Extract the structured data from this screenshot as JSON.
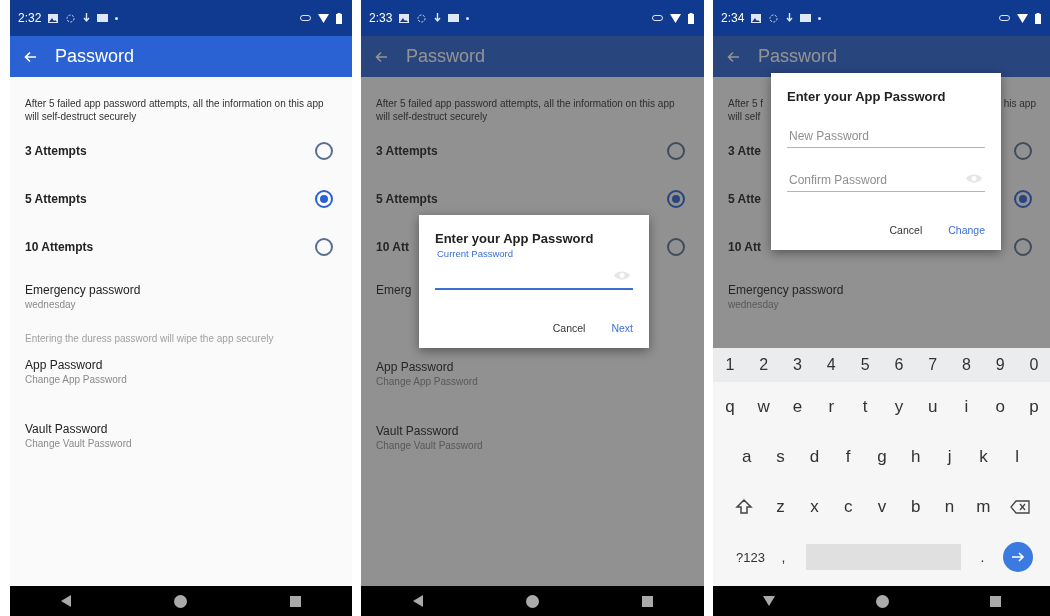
{
  "phones": [
    {
      "status_time": "2:32",
      "title": "Password",
      "description": "After 5 failed app password attempts, all the information on this app will self-destruct securely",
      "options": [
        {
          "label": "3 Attempts",
          "selected": false
        },
        {
          "label": "5 Attempts",
          "selected": true
        },
        {
          "label": "10 Attempts",
          "selected": false
        }
      ],
      "emergency": {
        "title": "Emergency password",
        "subtitle": "wednesday"
      },
      "note": "Entering the duress password will wipe the app securely",
      "settings": [
        {
          "title": "App Password",
          "subtitle": "Change App Password"
        },
        {
          "title": "Vault Password",
          "subtitle": "Change Vault Password"
        }
      ]
    },
    {
      "status_time": "2:33",
      "title": "Password",
      "description": "After 5 failed app password attempts, all the information on this app will self-destruct securely",
      "options": [
        {
          "label": "3 Attempts",
          "selected": false
        },
        {
          "label": "5 Attempts",
          "selected": true
        },
        {
          "label": "10 Att",
          "selected": false
        }
      ],
      "emergency": {
        "title": "Emerg"
      },
      "settings": [
        {
          "title": "App Password",
          "subtitle": "Change App Password"
        },
        {
          "title": "Vault Password",
          "subtitle": "Change Vault Password"
        }
      ],
      "dialog": {
        "title": "Enter your App Password",
        "fields": [
          {
            "label": "Current Password",
            "show_toggle": true,
            "focused": true
          }
        ],
        "buttons": [
          {
            "label": "Cancel",
            "primary": false
          },
          {
            "label": "Next",
            "primary": true
          }
        ]
      }
    },
    {
      "status_time": "2:34",
      "title": "Password",
      "description_fragments": [
        {
          "left": "After 5 f",
          "right": "his app"
        },
        {
          "left": "will self"
        }
      ],
      "options": [
        {
          "label": "3 Atte",
          "selected": false
        },
        {
          "label": "5 Atte",
          "selected": true
        },
        {
          "label": "10 Att",
          "selected": false
        }
      ],
      "emergency": {
        "title": "Emergency password",
        "subtitle": "wednesday"
      },
      "dialog": {
        "title": "Enter your App Password",
        "fields": [
          {
            "placeholder": "New Password",
            "show_toggle": false,
            "focused": false
          },
          {
            "placeholder": "Confirm Password",
            "show_toggle": true,
            "focused": false
          }
        ],
        "buttons": [
          {
            "label": "Cancel",
            "primary": false
          },
          {
            "label": "Change",
            "primary": true
          }
        ]
      },
      "keyboard": {
        "number_row": [
          "1",
          "2",
          "3",
          "4",
          "5",
          "6",
          "7",
          "8",
          "9",
          "0"
        ],
        "letter_rows": [
          [
            "q",
            "w",
            "e",
            "r",
            "t",
            "y",
            "u",
            "i",
            "o",
            "p"
          ],
          [
            "a",
            "s",
            "d",
            "f",
            "g",
            "h",
            "j",
            "k",
            "l"
          ],
          [
            "z",
            "x",
            "c",
            "v",
            "b",
            "n",
            "m"
          ]
        ],
        "symbols": "?123",
        "comma": ",",
        "period": "."
      }
    }
  ]
}
